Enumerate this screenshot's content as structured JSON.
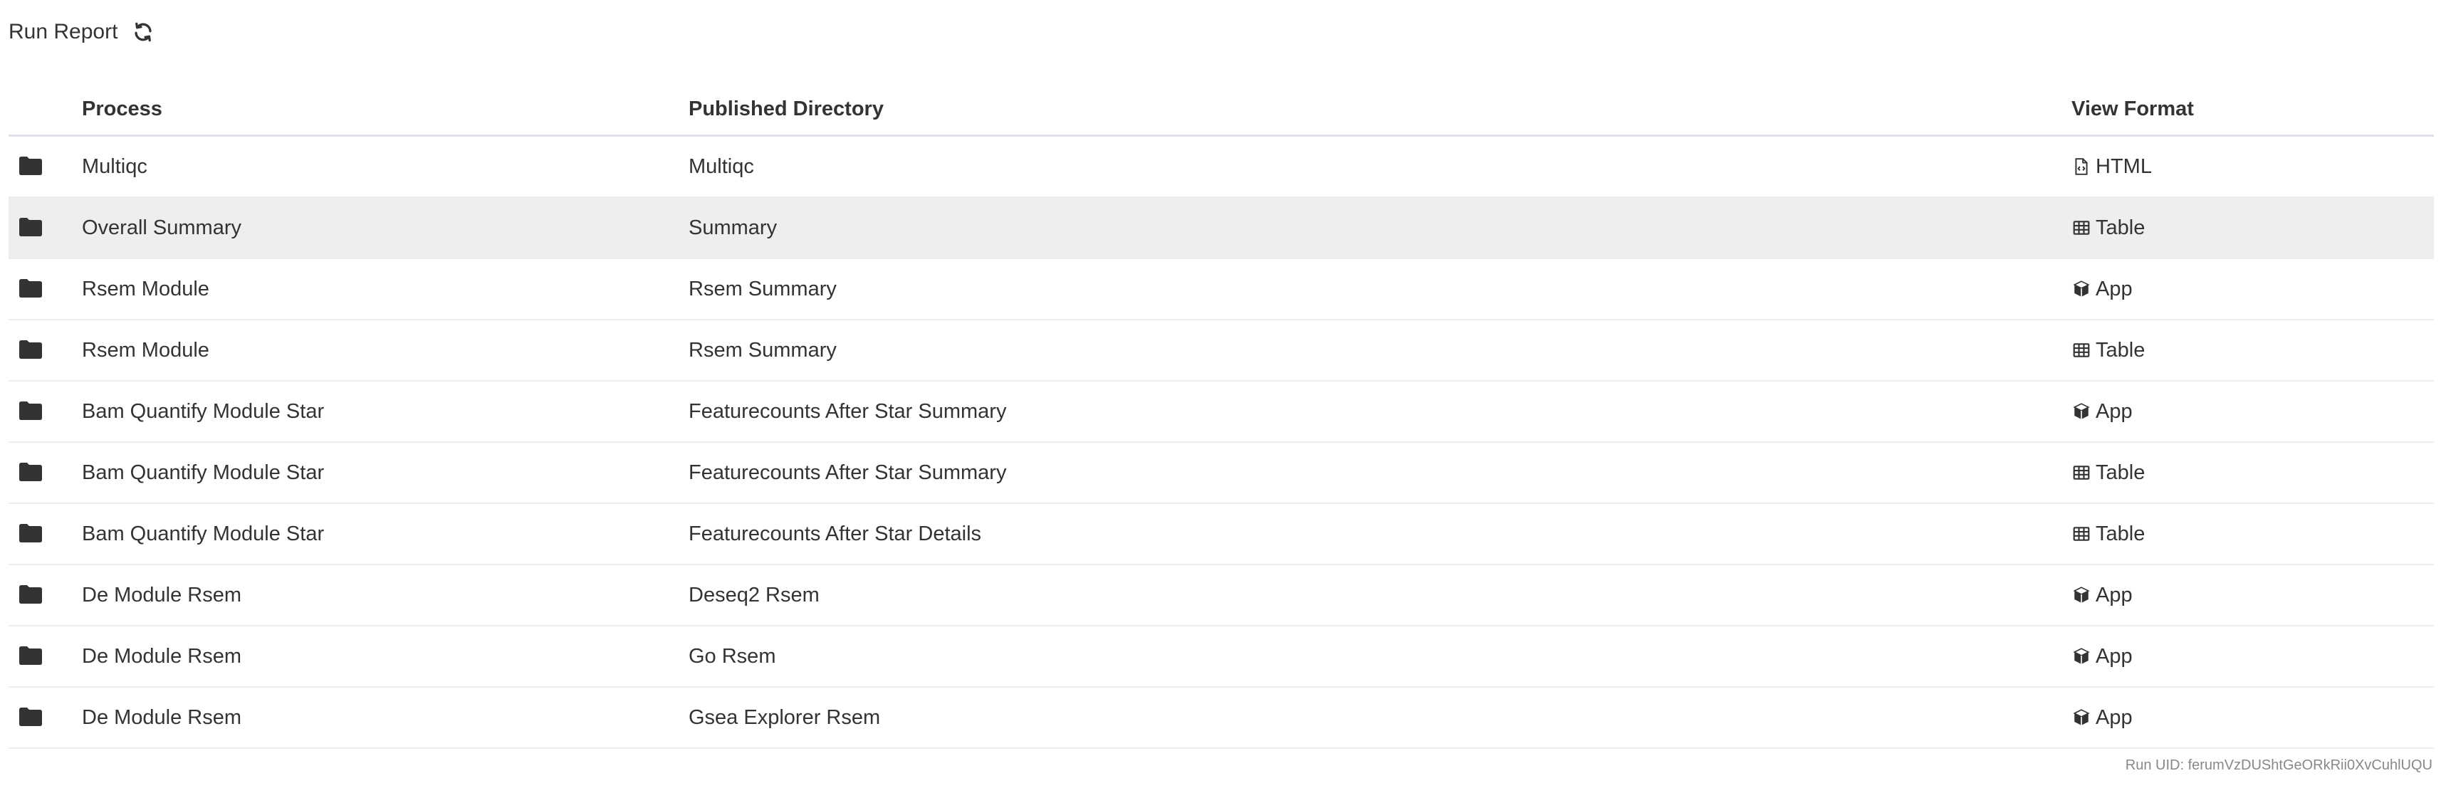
{
  "header": {
    "title": "Run Report",
    "refresh_icon": "refresh-icon"
  },
  "table": {
    "columns": {
      "process": "Process",
      "directory": "Published Directory",
      "format": "View Format"
    },
    "rows": [
      {
        "process": "Multiqc",
        "directory": "Multiqc",
        "format": "HTML",
        "format_icon": "file-code-icon",
        "highlighted": false
      },
      {
        "process": "Overall Summary",
        "directory": "Summary",
        "format": "Table",
        "format_icon": "table-icon",
        "highlighted": true
      },
      {
        "process": "Rsem Module",
        "directory": "Rsem Summary",
        "format": "App",
        "format_icon": "cube-icon",
        "highlighted": false
      },
      {
        "process": "Rsem Module",
        "directory": "Rsem Summary",
        "format": "Table",
        "format_icon": "table-icon",
        "highlighted": false
      },
      {
        "process": "Bam Quantify Module Star",
        "directory": "Featurecounts After Star Summary",
        "format": "App",
        "format_icon": "cube-icon",
        "highlighted": false
      },
      {
        "process": "Bam Quantify Module Star",
        "directory": "Featurecounts After Star Summary",
        "format": "Table",
        "format_icon": "table-icon",
        "highlighted": false
      },
      {
        "process": "Bam Quantify Module Star",
        "directory": "Featurecounts After Star Details",
        "format": "Table",
        "format_icon": "table-icon",
        "highlighted": false
      },
      {
        "process": "De Module Rsem",
        "directory": "Deseq2 Rsem",
        "format": "App",
        "format_icon": "cube-icon",
        "highlighted": false
      },
      {
        "process": "De Module Rsem",
        "directory": "Go Rsem",
        "format": "App",
        "format_icon": "cube-icon",
        "highlighted": false
      },
      {
        "process": "De Module Rsem",
        "directory": "Gsea Explorer Rsem",
        "format": "App",
        "format_icon": "cube-icon",
        "highlighted": false
      }
    ]
  },
  "footer": {
    "run_uid": "Run UID: ferumVzDUShtGeORkRii0XvCuhlUQU"
  },
  "colors": {
    "text": "#333333",
    "highlight_row": "#eceeef",
    "border": "#dee2e6",
    "muted": "#888888"
  }
}
